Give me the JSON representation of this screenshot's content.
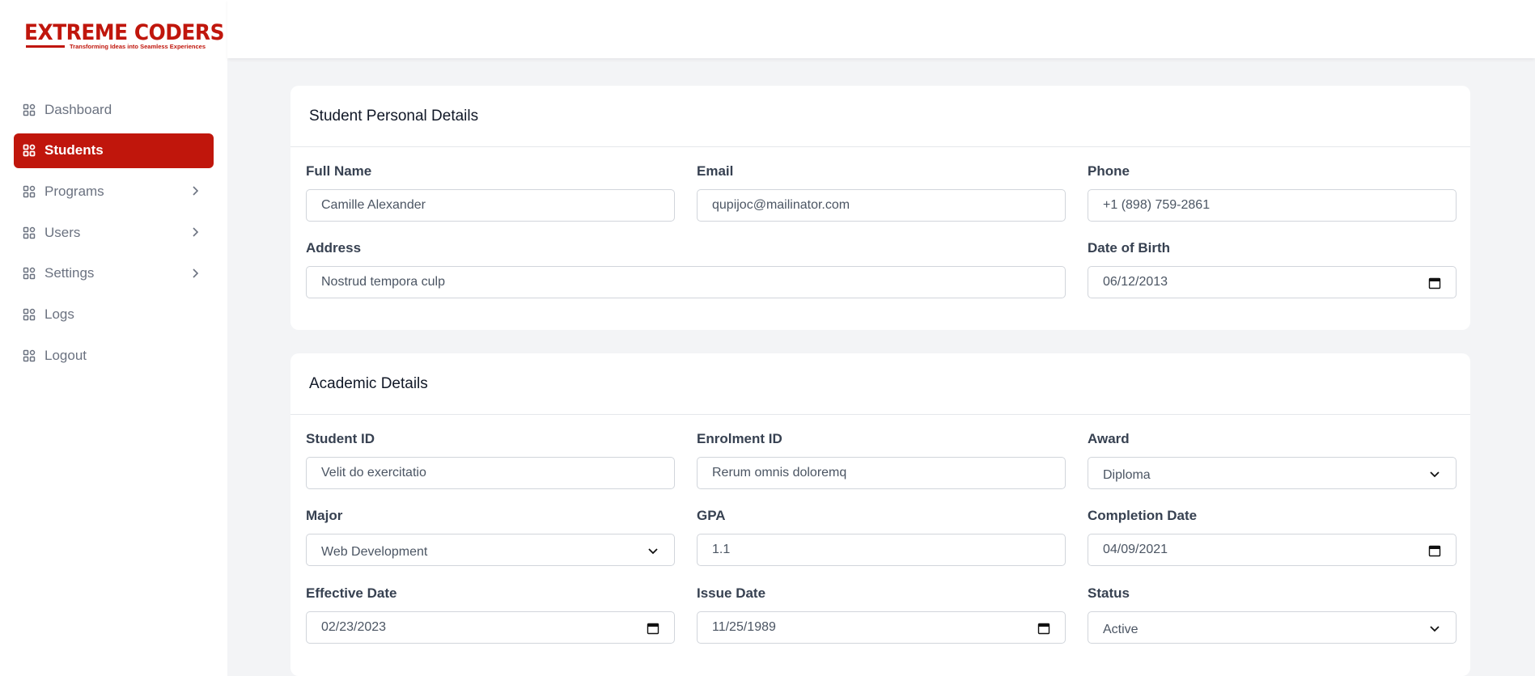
{
  "brand": {
    "name": "EXTREME CODERS",
    "tagline": "Transforming Ideas into Seamless Experiences",
    "accent": "#c0160c"
  },
  "sidebar": {
    "items": [
      {
        "label": "Dashboard",
        "icon": "grid-icon",
        "has_submenu": false,
        "active": false
      },
      {
        "label": "Students",
        "icon": "grid-icon",
        "has_submenu": false,
        "active": true
      },
      {
        "label": "Programs",
        "icon": "grid-icon",
        "has_submenu": true,
        "active": false
      },
      {
        "label": "Users",
        "icon": "grid-icon",
        "has_submenu": true,
        "active": false
      },
      {
        "label": "Settings",
        "icon": "grid-icon",
        "has_submenu": true,
        "active": false
      },
      {
        "label": "Logs",
        "icon": "grid-icon",
        "has_submenu": false,
        "active": false
      },
      {
        "label": "Logout",
        "icon": "grid-icon",
        "has_submenu": false,
        "active": false
      }
    ]
  },
  "personal": {
    "title": "Student Personal Details",
    "full_name": {
      "label": "Full Name",
      "value": "Camille Alexander"
    },
    "email": {
      "label": "Email",
      "value": "qupijoc@mailinator.com"
    },
    "phone": {
      "label": "Phone",
      "value": "+1 (898) 759-2861"
    },
    "address": {
      "label": "Address",
      "value": "Nostrud tempora culp"
    },
    "dob": {
      "label": "Date of Birth",
      "value": "06/12/2013"
    }
  },
  "academic": {
    "title": "Academic Details",
    "student_id": {
      "label": "Student ID",
      "value": "Velit do exercitatio"
    },
    "enrolment_id": {
      "label": "Enrolment ID",
      "value": "Rerum omnis doloremq"
    },
    "award": {
      "label": "Award",
      "value": "Diploma"
    },
    "major": {
      "label": "Major",
      "value": "Web Development"
    },
    "gpa": {
      "label": "GPA",
      "value": "1.1"
    },
    "completion_date": {
      "label": "Completion Date",
      "value": "04/09/2021"
    },
    "effective_date": {
      "label": "Effective Date",
      "value": "02/23/2023"
    },
    "issue_date": {
      "label": "Issue Date",
      "value": "11/25/1989"
    },
    "status": {
      "label": "Status",
      "value": "Active"
    }
  }
}
